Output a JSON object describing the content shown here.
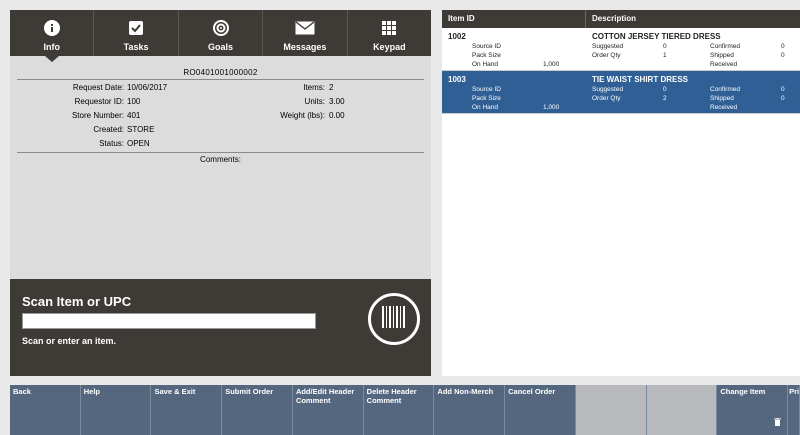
{
  "nav": {
    "tabs": [
      {
        "label": "Info",
        "icon": "info-icon"
      },
      {
        "label": "Tasks",
        "icon": "checkbox-icon"
      },
      {
        "label": "Goals",
        "icon": "target-icon"
      },
      {
        "label": "Messages",
        "icon": "envelope-icon"
      },
      {
        "label": "Keypad",
        "icon": "keypad-icon"
      }
    ]
  },
  "order": {
    "doc_number": "RO0401001000002",
    "request_date_label": "Request Date:",
    "request_date": "10/06/2017",
    "requestor_label": "Requestor ID:",
    "requestor": "100",
    "store_label": "Store Number:",
    "store": "401",
    "created_label": "Created:",
    "created": "STORE",
    "status_label": "Status:",
    "status": "OPEN",
    "items_label": "Items:",
    "items": "2",
    "units_label": "Units:",
    "units": "3.00",
    "weight_label": "Weight (lbs):",
    "weight": "0.00",
    "comments_label": "Comments:"
  },
  "scan": {
    "title": "Scan Item or UPC",
    "hint": "Scan or enter an item.",
    "value": ""
  },
  "table": {
    "col_item": "Item ID",
    "col_desc": "Description",
    "rows": [
      {
        "id": "1002",
        "desc": "COTTON JERSEY TIERED DRESS",
        "source_id_label": "Source ID",
        "source_id": "",
        "pack_size_label": "Pack Size",
        "pack_size": "",
        "on_hand_label": "On Hand",
        "on_hand": "1,000",
        "suggested_label": "Suggested",
        "suggested": "0",
        "order_qty_label": "Order Qty",
        "order_qty": "1",
        "confirmed_label": "Confirmed",
        "confirmed": "0",
        "shipped_label": "Shipped",
        "shipped": "0",
        "received_label": "Received",
        "received": ""
      },
      {
        "id": "1003",
        "desc": "TIE WAIST SHIRT DRESS",
        "source_id_label": "Source ID",
        "source_id": "",
        "pack_size_label": "Pack Size",
        "pack_size": "",
        "on_hand_label": "On Hand",
        "on_hand": "1,000",
        "suggested_label": "Suggested",
        "suggested": "0",
        "order_qty_label": "Order Qty",
        "order_qty": "2",
        "confirmed_label": "Confirmed",
        "confirmed": "0",
        "shipped_label": "Shipped",
        "shipped": "0",
        "received_label": "Received",
        "received": ""
      }
    ]
  },
  "toolbar": {
    "back": "Back",
    "help": "Help",
    "save_exit": "Save & Exit",
    "submit_order": "Submit Order",
    "add_edit_header": "Add/Edit Header Comment",
    "delete_header": "Delete Header Comment",
    "add_non_merch": "Add Non-Merch",
    "cancel_order": "Cancel Order",
    "disabled_1": "",
    "disabled_2": "",
    "change_item": "Change Item",
    "last": "Pri"
  },
  "colors": {
    "nav_bg": "#3e3b36",
    "selected_row": "#2f5f95",
    "toolbar_btn": "#55677e",
    "toolbar_disabled": "#b7b9bc"
  }
}
